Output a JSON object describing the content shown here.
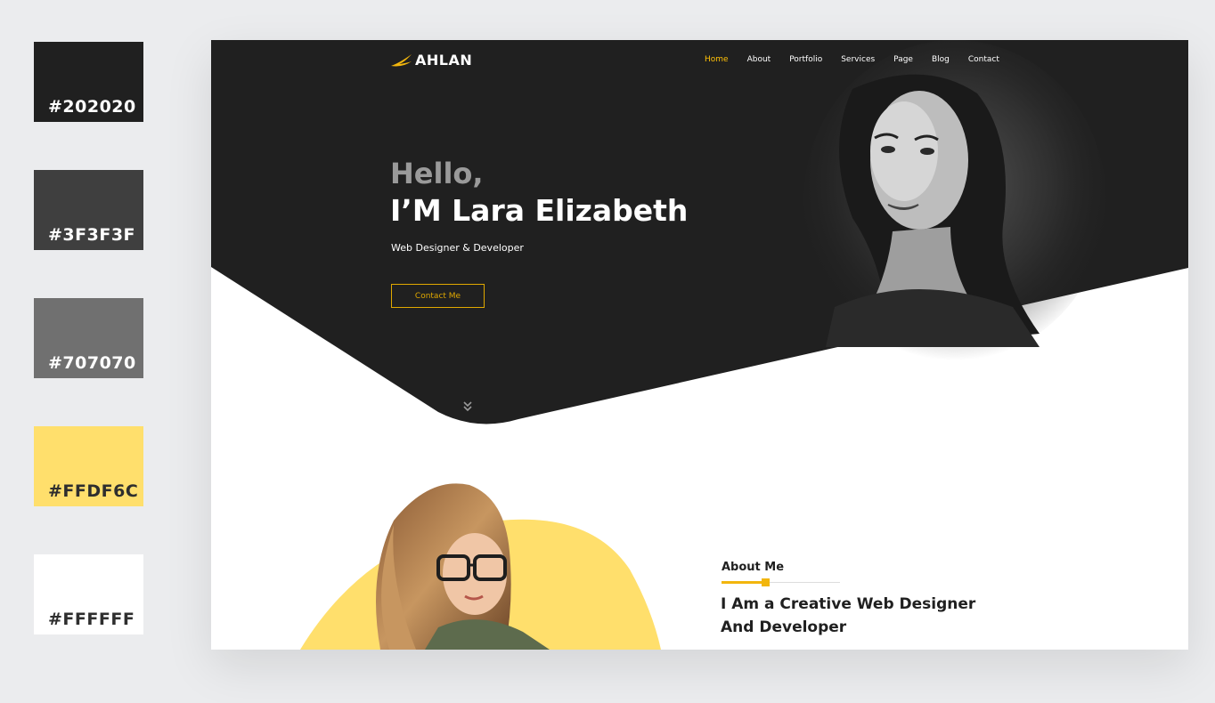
{
  "palette": [
    {
      "code": "#202020",
      "color": "#202020",
      "text_color": "#ffffff"
    },
    {
      "code": "#3F3F3F",
      "color": "#3F3F3F",
      "text_color": "#ffffff"
    },
    {
      "code": "#707070",
      "color": "#707070",
      "text_color": "#ffffff"
    },
    {
      "code": "#FFDF6C",
      "color": "#FFDF6C",
      "text_color": "#2e2e2e"
    },
    {
      "code": "#FFFFFF",
      "color": "#FFFFFF",
      "text_color": "#2e2e2e"
    }
  ],
  "site": {
    "logo": "AHLAN",
    "logo_icon": "swoosh-icon",
    "accent": "#f2b60d",
    "nav": [
      "Home",
      "About",
      "Portfolio",
      "Services",
      "Page",
      "Blog",
      "Contact"
    ],
    "nav_active": "Home"
  },
  "hero": {
    "greeting": "Hello,",
    "name": "I’M Lara Elizabeth",
    "subtitle": "Web Designer & Developer",
    "cta": "Contact Me",
    "scroll_icon": "double-chevron-down-icon"
  },
  "about": {
    "label": "About Me",
    "heading_line1": "I Am a Creative Web Designer",
    "heading_line2": "And Developer"
  }
}
